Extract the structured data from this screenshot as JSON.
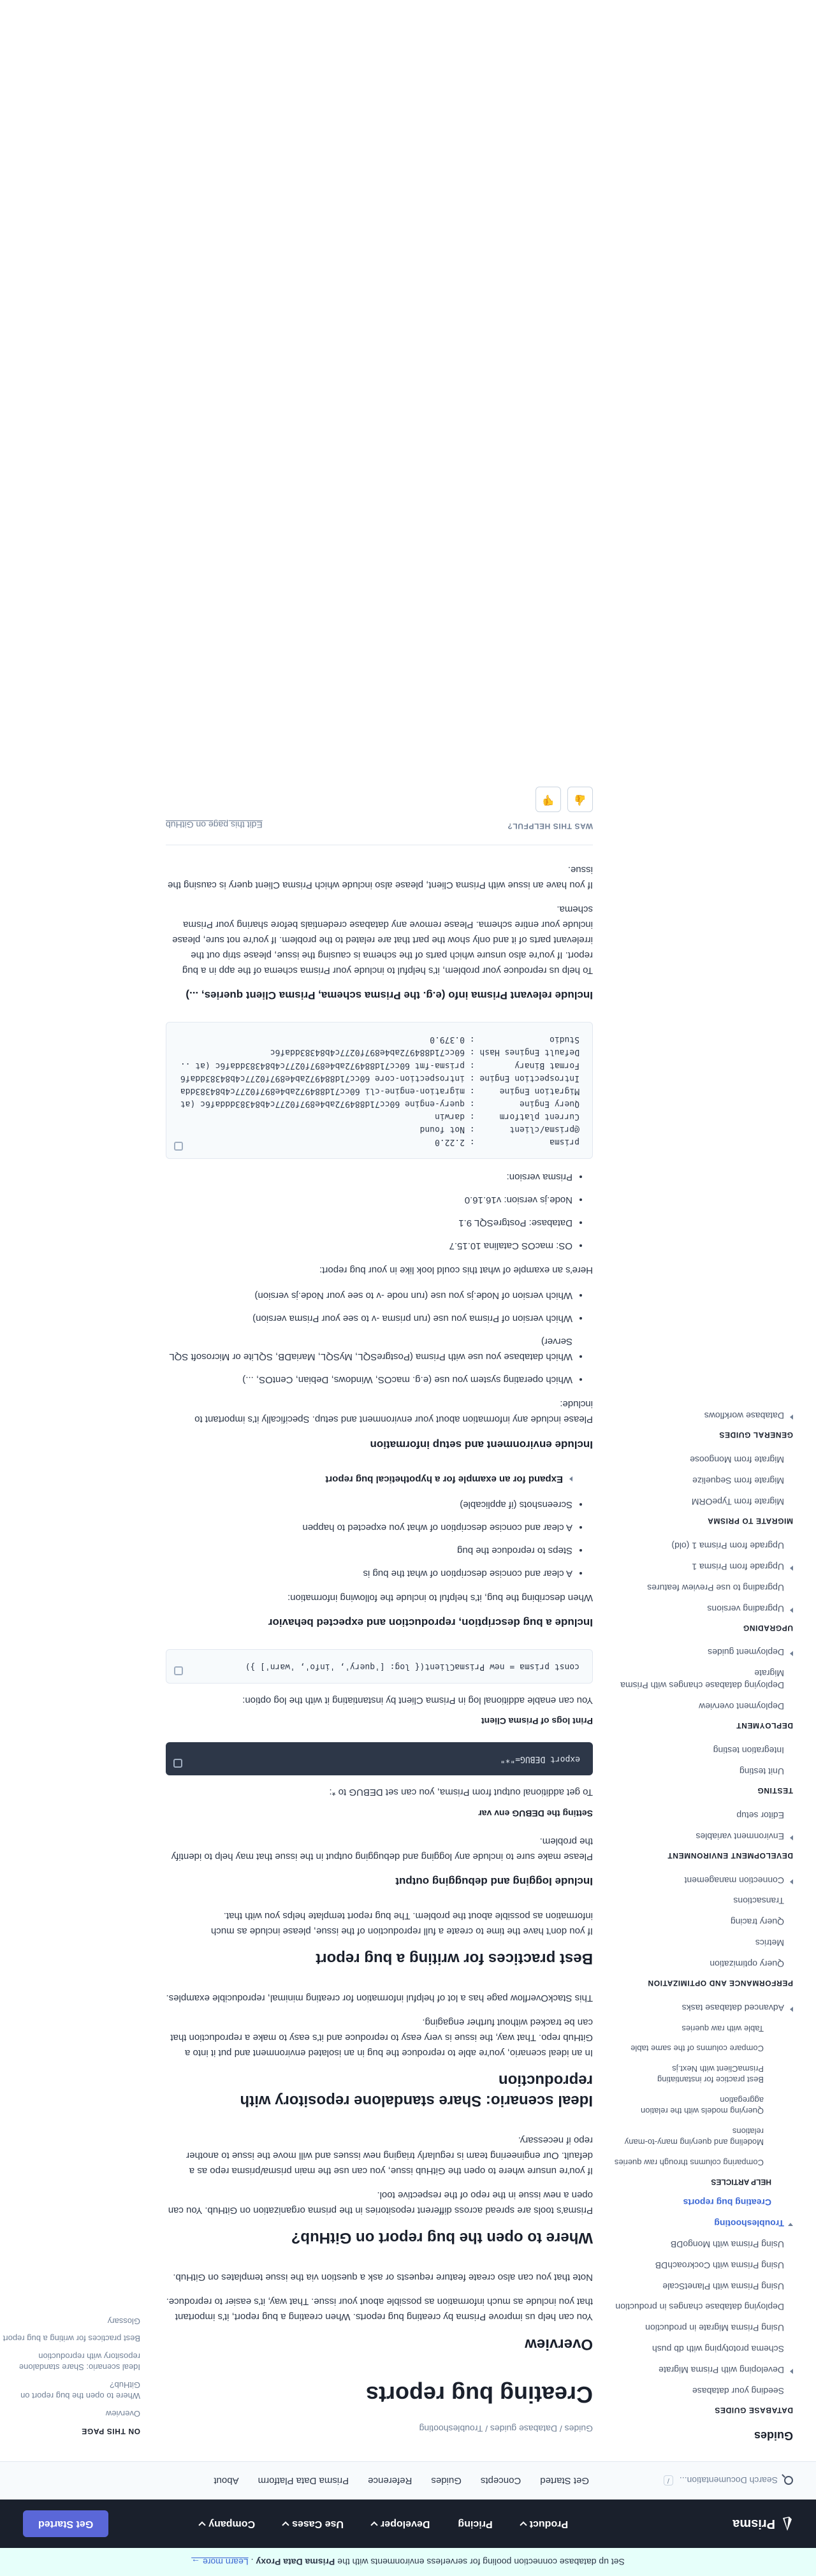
{
  "banner": {
    "text": "Set up database connection pooling for serverless environments with the",
    "product": "Prisma Data Proxy",
    "cta": "Learn more →"
  },
  "topnav": {
    "brand": "Prisma",
    "items": [
      "Product",
      "Pricing",
      "Developer",
      "Use Cases",
      "Company"
    ],
    "cta": "Get Started"
  },
  "subnav": {
    "search_placeholder": "Search Documentation...",
    "shortcut": "/",
    "links": [
      "Get Started",
      "Concepts",
      "Guides",
      "Reference",
      "Prisma Data Platform",
      "About"
    ]
  },
  "sidebar": {
    "title": "Guides",
    "items": [
      {
        "label": "DATABASE GUIDES",
        "type": "section"
      },
      {
        "label": "Seeding your database",
        "type": "item",
        "level": 1
      },
      {
        "label": "Developing with Prisma Migrate",
        "type": "item",
        "level": 1,
        "arrow": "closed"
      },
      {
        "label": "Schema prototyping with db push",
        "type": "item",
        "level": 1
      },
      {
        "label": "Using Prisma Migrate in production",
        "type": "item",
        "level": 1
      },
      {
        "label": "Deploying database changes in production",
        "type": "item",
        "level": 1
      },
      {
        "label": "Using Prisma with PlanetScale",
        "type": "item",
        "level": 1
      },
      {
        "label": "Using Prisma with CockroachDB",
        "type": "item",
        "level": 1
      },
      {
        "label": "Using Prisma with MongoDB",
        "type": "item",
        "level": 1
      },
      {
        "label": "Troubleshooting",
        "type": "item",
        "level": 1,
        "arrow": "open",
        "active": true
      },
      {
        "label": "Creating bug reports",
        "type": "item",
        "level": 2,
        "active": true
      },
      {
        "label": "HELP ARTICLES",
        "type": "subsection"
      },
      {
        "label": "Comparing columns through raw queries",
        "type": "item",
        "level": 3
      },
      {
        "label": "Modeling and querying many-to-many relations",
        "type": "item",
        "level": 3
      },
      {
        "label": "Querying models with the relation aggregation",
        "type": "item",
        "level": 3
      },
      {
        "label": "Best practice for instantiating PrismaClient with Next.js",
        "type": "item",
        "level": 3
      },
      {
        "label": "Compare columns of the same table",
        "type": "item",
        "level": 3
      },
      {
        "label": "Table with raw queries",
        "type": "item",
        "level": 3
      },
      {
        "label": "Advanced database tasks",
        "type": "item",
        "level": 1,
        "arrow": "closed"
      },
      {
        "label": "PERFORMANCE AND OPTIMIZATION",
        "type": "section"
      },
      {
        "label": "Query optimization",
        "type": "item",
        "level": 1
      },
      {
        "label": "Metrics",
        "type": "item",
        "level": 1
      },
      {
        "label": "Query tracing",
        "type": "item",
        "level": 1
      },
      {
        "label": "Transactions",
        "type": "item",
        "level": 1
      },
      {
        "label": "Connection management",
        "type": "item",
        "level": 1,
        "arrow": "closed"
      },
      {
        "label": "DEVELOPMENT ENVIRONMENT",
        "type": "section"
      },
      {
        "label": "Environment variables",
        "type": "item",
        "level": 1,
        "arrow": "closed"
      },
      {
        "label": "Editor setup",
        "type": "item",
        "level": 1
      },
      {
        "label": "TESTING",
        "type": "section"
      },
      {
        "label": "Unit testing",
        "type": "item",
        "level": 1
      },
      {
        "label": "Integration testing",
        "type": "item",
        "level": 1
      },
      {
        "label": "DEPLOYMENT",
        "type": "section"
      },
      {
        "label": "Deployment overview",
        "type": "item",
        "level": 1
      },
      {
        "label": "Deploying database changes with Prisma Migrate",
        "type": "item",
        "level": 1
      },
      {
        "label": "Deployment guides",
        "type": "item",
        "level": 1,
        "arrow": "closed"
      },
      {
        "label": "UPGRADING",
        "type": "section"
      },
      {
        "label": "Upgrading versions",
        "type": "item",
        "level": 1,
        "arrow": "closed"
      },
      {
        "label": "Upgrading to use Preview features",
        "type": "item",
        "level": 1
      },
      {
        "label": "Upgrade from Prisma 1",
        "type": "item",
        "level": 1,
        "arrow": "closed"
      },
      {
        "label": "Upgrade from Prisma 1 (old)",
        "type": "item",
        "level": 1
      },
      {
        "label": "MIGRATE TO PRISMA",
        "type": "section"
      },
      {
        "label": "Migrate from TypeORM",
        "type": "item",
        "level": 1
      },
      {
        "label": "Migrate from Sequelize",
        "type": "item",
        "level": 1
      },
      {
        "label": "Migrate from Mongoose",
        "type": "item",
        "level": 1
      },
      {
        "label": "GENERAL GUIDES",
        "type": "section"
      },
      {
        "label": "Database workflows",
        "type": "item",
        "level": 1,
        "arrow": "closed"
      }
    ]
  },
  "main": {
    "breadcrumb": "Guides / Database guides / Troubleshooting",
    "title": "Creating bug reports",
    "overview_heading": "Overview",
    "overview_p1": "You can help us improve Prisma by creating bug reports. When creating a bug report, it's important that you include as much information as possible about your issue. That way, it's easier to reproduce.",
    "overview_p2": "Note that you can also create feature requests or ask a question via the issue templates on GitHub.",
    "github_heading": "Where to open the bug report on GitHub?",
    "github_p1": "Prisma's tools are spread across different repositories in the prisma organization on GitHub. You can open a new issue in the repo of the respective tool.",
    "github_p2": "If you're unsure where to open the GitHub issue, you can use the main prisma/prisma repo as a default. Our engineering team is regularly triaging new issues and will move the issue to another repo if necessary.",
    "ideal_heading": "Ideal scenario: Share standalone repository with reproduction",
    "ideal_p1": "In an ideal scenario, you're able to reproduce the bug in an isolated environment and put it into a GitHub repo. That way, the issue is very easy to reproduce and it's easy to make a reproduction that can be tracked without further engaging.",
    "ideal_p2": "This StackOverflow page has a lot of helpful information for creating minimal, reproducible examples.",
    "best_heading": "Best practices for writing a bug report",
    "best_p1": "If you don't have the time to create a full reproduction of the issue, please include as much information as possible about the problem. The bug report template helps you with that.",
    "logging_heading": "Include logging and debugging output",
    "logging_p1": "Please make sure to include any logging and debugging output in the issue that may help to identify the problem.",
    "debug_heading": "Setting the DEBUG env var",
    "debug_p1": "To get additional output from Prisma, you can set DEBUG to *:",
    "debug_code": "export DEBUG=\"*\"",
    "log_heading": "Print logs of Prisma Client",
    "log_p1": "You can enable additional log in Prisma Client by instantiating it with the log option:",
    "log_code": "const prisma = new PrismaClient({ log: ['query', 'info', 'warn'] })",
    "bug_heading": "Include a bug description, reproduction and expected behavior",
    "bug_p1": "When describing the bug, it's helpful to include the following information:",
    "bug_list": [
      "A clear and concise description of what the bug is",
      "Steps to reproduce the bug",
      "A clear and concise description of what you expected to happen",
      "Screenshots (if applicable)"
    ],
    "bug_details": "Expand for an example for a hypothetical bug report",
    "env_heading": "Include environment and setup information",
    "env_p1": "Please include any information about your environment and setup. Specifically it's important to include:",
    "env_list": [
      "Which operating system you use (e.g. macOS, Windows, Debian, CentOS, ...)",
      "Which database you use with Prisma (PostgreSQL, MySQL, MariaDB, SQLite or Microsoft SQL Server)",
      "Which version of Prisma you use (run prisma -v to see your Prisma version)",
      "Which version of Node.js you use (run node -v to see your Node.js version)"
    ],
    "env_example_intro": "Here's an example of what this could look like in your bug report:",
    "env_example": [
      "OS: macOS Catalina 10.15.7",
      "Database: PostgreSQL 9.1",
      "Node.js version: v16.16.0",
      "Prisma version:"
    ],
    "version_code": "prisma               : 2.22.0\n@prisma/client       : Not found\nCurrent platform     : darwin\nQuery Engine         : query-engine 60cc71d884972ab4e897f0277c4b84383dddaf6c (at\nMigration Engine     : migration-engine-cli 60cc71d884972ab4e897f0277c4b84383dda\nIntrospection Engine : introspection-core 60cc71d884972ab4e897f0277c4b84383ddaf6\nFormat Binary        : prisma-fmt 60cc71d884972ab4e897f0277c4b84383ddaf6c (at ..\nDefault Engines Hash : 60cc71d884972ab4e897f0277c4b84383ddaf6c\nStudio               : 0.379.0",
    "schema_heading": "Include relevant Prisma info (e.g. the Prisma schema, Prisma Client queries, ...)",
    "schema_p1": "To help us reproduce your problem, it's helpful to include your Prisma schema of the app in a bug report. If you're also unsure which parts of the schema is causing the issue, please strip out the irrelevant parts of it and only show the part that are related to the problem. If you're not sure, please include your entire schema. Please remove any database credentials before sharing your Prisma schema.",
    "schema_p2": "If you have an issue with Prisma Client, please also include which Prisma Client query is causing the issue.",
    "feedback_label": "WAS THIS HELPFUL?",
    "edit_link": "Edit this page on GitHub"
  },
  "toc": {
    "title": "ON THIS PAGE",
    "items": [
      {
        "label": "Overview",
        "sub": false
      },
      {
        "label": "Where to open the bug report on GitHub?",
        "sub": false
      },
      {
        "label": "Ideal scenario: Share standalone repository with reproduction",
        "sub": false
      },
      {
        "label": "Best practices for writing a bug report",
        "sub": false
      },
      {
        "label": "Glossary",
        "sub": false
      }
    ]
  }
}
